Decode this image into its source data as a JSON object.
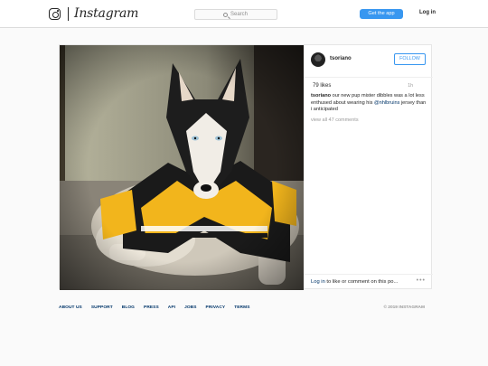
{
  "app": {
    "wordmark": "Instagram"
  },
  "nav": {
    "search_placeholder": "Search",
    "get_app_label": "Get the app",
    "login_label": "Log in"
  },
  "post": {
    "username": "tsoriano",
    "follow_label": "FOLLOW",
    "likes": "79 likes",
    "time": "1h",
    "caption": {
      "author": "tsoriano",
      "text_before": " our new pup mister dibbles was a lot less enthused about wearing his ",
      "mention": "@nhlbruins",
      "text_after": " jersey than i anticipated"
    },
    "view_all_comments": "view all 47 comments",
    "comment_link": "Log in",
    "comment_rest": " to like or comment on this po...",
    "more_label": "•••"
  },
  "footer": {
    "links": [
      "ABOUT US",
      "SUPPORT",
      "BLOG",
      "PRESS",
      "API",
      "JOBS",
      "PRIVACY",
      "TERMS"
    ],
    "copyright": "© 2019 INSTAGRAM"
  },
  "colors": {
    "accent": "#3897f0",
    "link": "#003569",
    "muted": "#999999"
  }
}
